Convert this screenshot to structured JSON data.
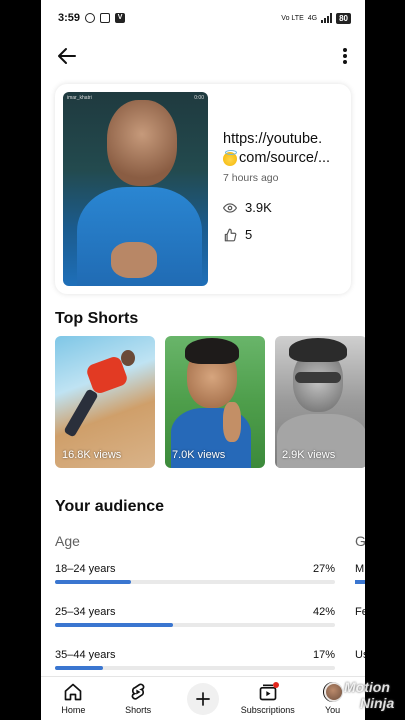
{
  "status_bar": {
    "time": "3:59",
    "network": "Vo LTE",
    "signal": "4G",
    "battery": "80"
  },
  "video": {
    "title_line1": "https://youtube.",
    "title_line2": "com/source/...",
    "posted": "7 hours ago",
    "views": "3.9K",
    "likes": "5",
    "thumb_caption": "imar_khatri",
    "thumb_time": "0:00"
  },
  "top_shorts": {
    "title": "Top Shorts",
    "items": [
      {
        "views": "16.8K views"
      },
      {
        "views": "7.0K views"
      },
      {
        "views": "2.9K views"
      }
    ]
  },
  "audience": {
    "title": "Your audience",
    "age_heading": "Age",
    "gender_heading": "G",
    "age_rows": [
      {
        "label": "18–24 years",
        "percent": "27%",
        "value": 27
      },
      {
        "label": "25–34 years",
        "percent": "42%",
        "value": 42
      },
      {
        "label": "35–44 years",
        "percent": "17%",
        "value": 17
      }
    ],
    "gender_rows": [
      "M",
      "Fe",
      "Us"
    ]
  },
  "bottom_nav": {
    "home": "Home",
    "shorts": "Shorts",
    "subscriptions": "Subscriptions",
    "you": "You"
  },
  "watermark": {
    "line1": "Motion",
    "line2": "Ninja"
  },
  "colors": {
    "accent": "#3a76d0",
    "notification": "#e1261c"
  }
}
